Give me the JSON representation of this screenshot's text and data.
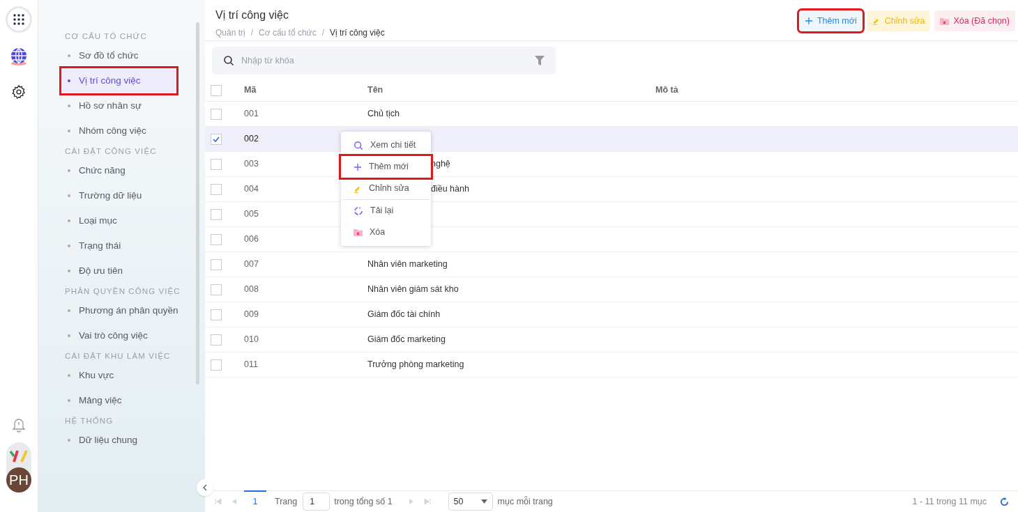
{
  "rail": {
    "avatar": "PH"
  },
  "sidebar": {
    "sections": [
      {
        "title": "CƠ CẤU TỔ CHỨC",
        "items": [
          {
            "label": "Sơ đồ tổ chức",
            "selected": false,
            "highlighted": false
          },
          {
            "label": "Vị trí công việc",
            "selected": true,
            "highlighted": true
          },
          {
            "label": "Hồ sơ nhân sự",
            "selected": false,
            "highlighted": false
          },
          {
            "label": "Nhóm công việc",
            "selected": false,
            "highlighted": false
          }
        ]
      },
      {
        "title": "CÀI ĐẶT CÔNG VIỆC",
        "items": [
          {
            "label": "Chức năng",
            "selected": false,
            "highlighted": false
          },
          {
            "label": "Trường dữ liệu",
            "selected": false,
            "highlighted": false
          },
          {
            "label": "Loại mục",
            "selected": false,
            "highlighted": false
          },
          {
            "label": "Trạng thái",
            "selected": false,
            "highlighted": false
          },
          {
            "label": "Độ ưu tiên",
            "selected": false,
            "highlighted": false
          }
        ]
      },
      {
        "title": "PHÂN QUYỀN CÔNG VIỆC",
        "items": [
          {
            "label": "Phương án phân quyền",
            "selected": false,
            "highlighted": false
          },
          {
            "label": "Vai trò công việc",
            "selected": false,
            "highlighted": false
          }
        ]
      },
      {
        "title": "CÀI ĐẶT KHU LÀM VIỆC",
        "items": [
          {
            "label": "Khu vực",
            "selected": false,
            "highlighted": false
          },
          {
            "label": "Mảng việc",
            "selected": false,
            "highlighted": false
          }
        ]
      },
      {
        "title": "HỆ THỐNG",
        "items": [
          {
            "label": "Dữ liệu chung",
            "selected": false,
            "highlighted": false
          }
        ]
      }
    ]
  },
  "header": {
    "title": "Vị trí công việc",
    "breadcrumb": [
      "Quản trị",
      "Cơ cấu tổ chức",
      "Vị trí công việc"
    ],
    "separator": "/",
    "actions": [
      {
        "kind": "add",
        "label": "Thêm mới",
        "highlighted": true
      },
      {
        "kind": "edit",
        "label": "Chỉnh sửa",
        "highlighted": false
      },
      {
        "kind": "delete",
        "label": "Xóa (Đã chọn)",
        "highlighted": false
      }
    ]
  },
  "search": {
    "placeholder": "Nhập từ khóa"
  },
  "table": {
    "columns": [
      "Mã",
      "Tên",
      "Mô tả"
    ],
    "header_checked": false,
    "rows": [
      {
        "code": "001",
        "name": "Chủ tịch",
        "checked": false
      },
      {
        "code": "002",
        "checked": true
      },
      {
        "code": "003",
        "name": "nghệ",
        "checked": false
      },
      {
        "code": "004",
        "name": "điều hành",
        "checked": false
      },
      {
        "code": "005",
        "checked": false
      },
      {
        "code": "006",
        "checked": false
      },
      {
        "code": "007",
        "name": "Nhân viên marketing",
        "checked": false
      },
      {
        "code": "008",
        "name": "Nhân viên giám sát kho",
        "checked": false
      },
      {
        "code": "009",
        "name": "Giám đốc tài chính",
        "checked": false
      },
      {
        "code": "010",
        "name": "Giám đốc marketing",
        "checked": false
      },
      {
        "code": "011",
        "name": "Trưởng phòng marketing",
        "checked": false
      }
    ]
  },
  "context_menu": [
    {
      "kind": "view",
      "label": "Xem chi tiết",
      "highlighted": false
    },
    {
      "kind": "add",
      "label": "Thêm mới",
      "highlighted": true
    },
    {
      "kind": "edit",
      "label": "Chỉnh sửa",
      "highlighted": false
    },
    {
      "kind": "reload",
      "label": "Tải lại",
      "highlighted": false
    },
    {
      "kind": "delete",
      "label": "Xóa",
      "highlighted": false
    }
  ],
  "pager": {
    "current_page": "1",
    "page_label": "Trang",
    "page_value": "1",
    "total": "trong tổng số 1",
    "page_size": "50",
    "page_size_label": "mục mỗi trang",
    "range": "1 - 11 trong 11 mục"
  }
}
